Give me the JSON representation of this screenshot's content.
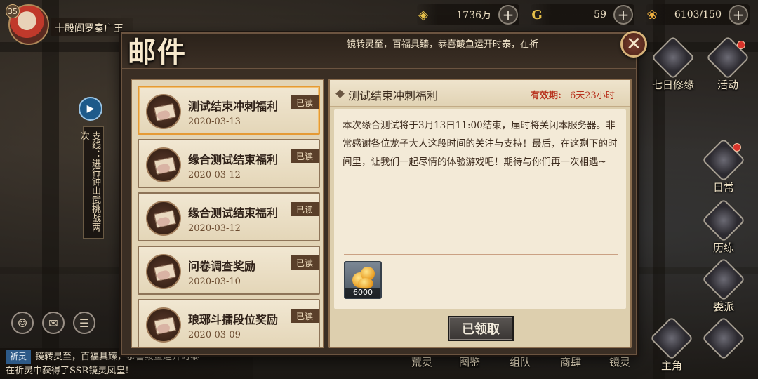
{
  "hud": {
    "level": "35",
    "player_name": "十殿阎罗秦广王",
    "resources": [
      {
        "icon": "coin-icon",
        "glyph": "◈",
        "value": "1736万"
      },
      {
        "icon": "jade-icon",
        "glyph": "G",
        "value": "59"
      },
      {
        "icon": "stamina-icon",
        "glyph": "❀",
        "value": "6103/150"
      }
    ],
    "plus": "+"
  },
  "quest": {
    "label": "支线：进行钟山武挑战两次"
  },
  "side_menu": {
    "seven_day": "七日修缘",
    "activity": "活动",
    "daily": "日常",
    "training": "历练",
    "dispatch": "委派",
    "protagonist": "主角"
  },
  "bottom_menu": [
    "荒灵",
    "图鉴",
    "组队",
    "商肆",
    "镜灵"
  ],
  "chat": {
    "tag": "祈灵",
    "line1": "镜转灵至，百福具臻，恭喜鲮鱼运开时泰",
    "line2": "在祈灵中获得了SSR镜灵凤皇!"
  },
  "mail": {
    "title": "邮件",
    "marquee": "镜转灵至，百福具臻，恭喜鲮鱼运开时泰，在祈",
    "close": "✕",
    "items": [
      {
        "title": "测试结束冲刺福利",
        "date": "2020-03-13",
        "badge": "已读"
      },
      {
        "title": "缘合测试结束福利",
        "date": "2020-03-12",
        "badge": "已读"
      },
      {
        "title": "缘合测试结束福利",
        "date": "2020-03-12",
        "badge": "已读"
      },
      {
        "title": "问卷调查奖励",
        "date": "2020-03-10",
        "badge": "已读"
      },
      {
        "title": "琅琊斗擂段位奖励",
        "date": "2020-03-09",
        "badge": "已读"
      }
    ],
    "detail": {
      "title": "测试结束冲刺福利",
      "expiry_label": "有效期:",
      "expiry_value": "6天23小时",
      "body": "本次缘合测试将于3月13日11:00结束，届时将关闭本服务器。非常感谢各位龙子大人这段时间的关注与支持！最后，在这剩下的时间里，让我们一起尽情的体验游戏吧！期待与你们再一次相遇~",
      "reward_qty": "6000",
      "claim_label": "已领取"
    }
  },
  "colors": {
    "accent_orange": "#e59a35",
    "expiry_red": "#b8321e",
    "panel_bg": "#e2d4b6"
  }
}
